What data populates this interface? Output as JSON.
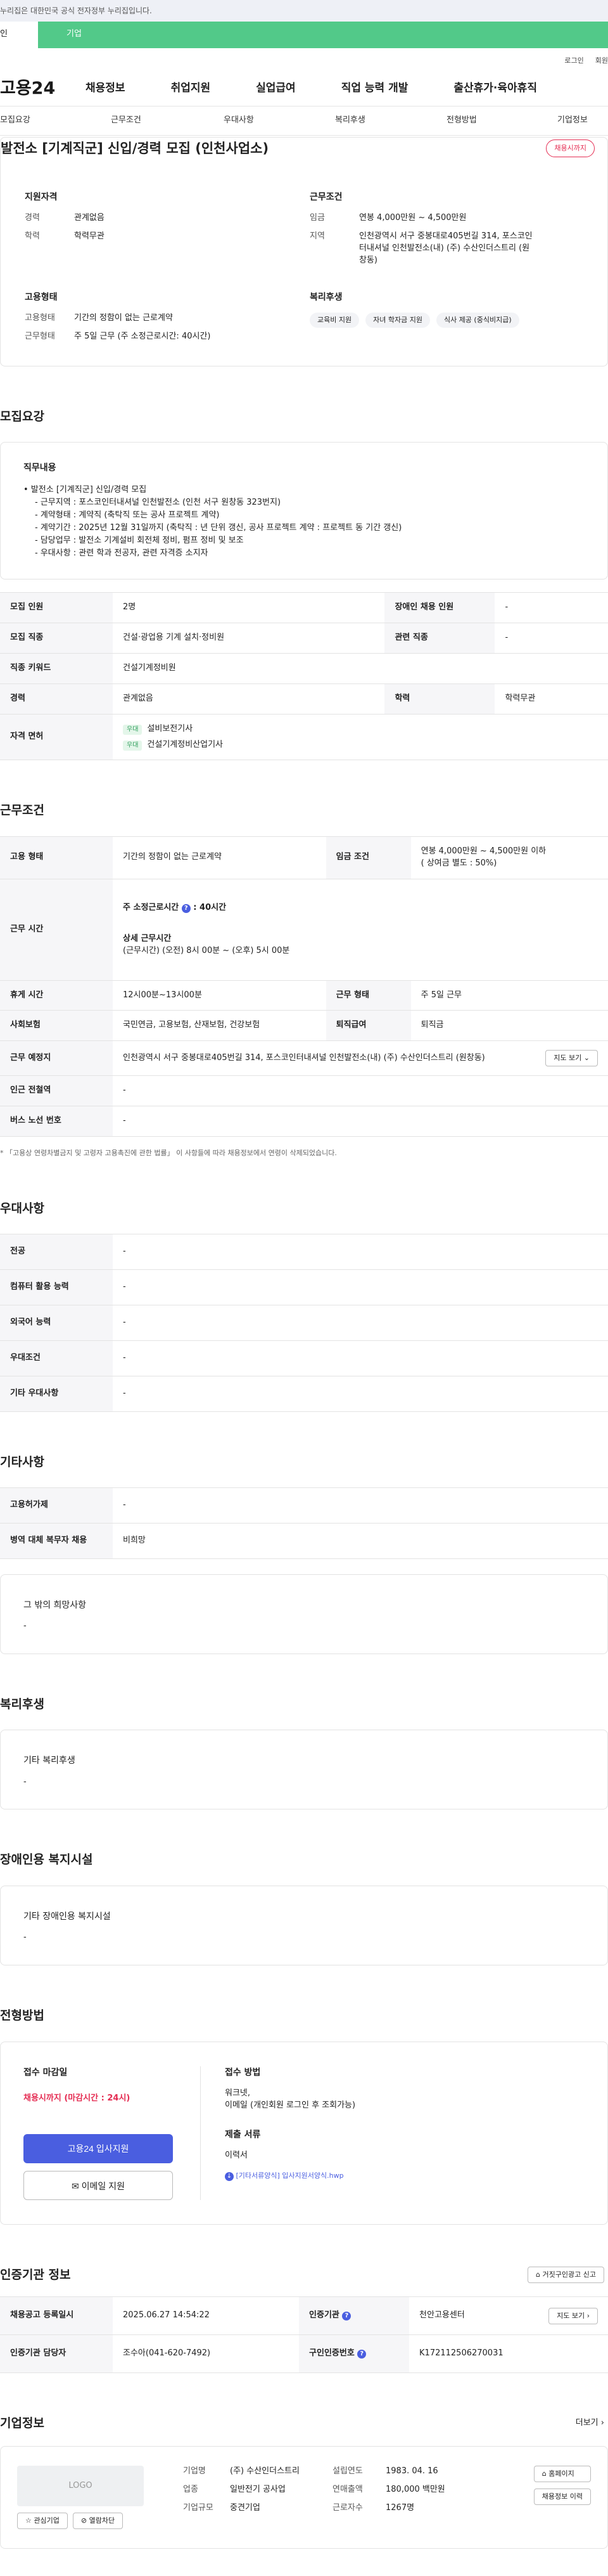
{
  "top_notice": "누리집은 대한민국 공식 전자정부 누리집입니다.",
  "user_tabs": {
    "individual": "인",
    "business": "기업"
  },
  "util_links": [
    "로그인",
    "회원"
  ],
  "logo": "고용24",
  "gnb": [
    "채용정보",
    "취업지원",
    "실업급여",
    "직업 능력 개발",
    "출산휴가·육아휴직"
  ],
  "subnav": [
    "모집요강",
    "근무조건",
    "우대사항",
    "복리후생",
    "전형방법",
    "기업정보"
  ],
  "job": {
    "title": "발전소 [기계직군] 신입/경력 모집 (인천사업소)",
    "deadline_badge": "채용시까지",
    "qual_head": "지원자격",
    "qual": [
      {
        "k": "경력",
        "v": "관계없음"
      },
      {
        "k": "학력",
        "v": "학력무관"
      }
    ],
    "cond_head": "근무조건",
    "cond": [
      {
        "k": "임금",
        "v": "연봉 4,000만원 ~ 4,500만원"
      },
      {
        "k": "지역",
        "v": "인천광역시 서구 중봉대로405번길 314, 포스코인터내셔널 인천발전소(내) (주) 수산인더스트리 (원창동)"
      }
    ],
    "emp_head": "고용형태",
    "emp": [
      {
        "k": "고용형태",
        "v": "기간의 정함이 없는 근로계약"
      },
      {
        "k": "근무형태",
        "v": "주 5일 근무 (주 소정근로시간: 40시간)"
      }
    ],
    "welfare_head": "복리후생",
    "welfare_chips": [
      "교육비 지원",
      "자녀 학자금 지원",
      "식사 제공 (중식비지급)"
    ]
  },
  "recruit": {
    "title": "모집요강",
    "duty_head": "직무내용",
    "duty_lines": [
      "• 발전소 [기계직군] 신입/경력 모집",
      "  - 근무지역 : 포스코인터내셔널 인천발전소 (인천 서구 원창동 323번지)",
      "  - 계약형태 : 계약직 (축탁직 또는 공사 프로젝트 계약)",
      "  - 계약기간 : 2025년 12월 31일까지 (축탁직 : 년 단위 갱신, 공사 프로젝트 계약 : 프로젝트 동 기간 갱신)",
      "  - 담당업무 : 발전소 기계설비 회전체 정비, 펌프 정비 및 보조",
      "  - 우대사항 : 관련 학과 전공자, 관련 자격증 소지자"
    ],
    "table": {
      "headcount_k": "모집 인원",
      "headcount_v": "2명",
      "disabled_k": "장애인 채용 인원",
      "disabled_v": "-",
      "job_k": "모집 직종",
      "job_v": "건설·광업용 기계 설치·정비원",
      "related_k": "관련 직종",
      "related_v": "-",
      "keyword_k": "직종 키워드",
      "keyword_v": "건설기계정비원",
      "career_k": "경력",
      "career_v": "관계없음",
      "edu_k": "학력",
      "edu_v": "학력무관",
      "license_k": "자격 면허",
      "licenses": [
        {
          "tag": "우대",
          "name": "설비보전기사"
        },
        {
          "tag": "우대",
          "name": "건설기계정비산업기사"
        }
      ]
    }
  },
  "work": {
    "title": "근무조건",
    "emp_k": "고용 형태",
    "emp_v": "기간의 정함이 없는 근로계약",
    "wage_k": "임금 조건",
    "wage_v": "연봉 4,000만원 ~ 4,500만원 이하",
    "wage_sub": "( 상여금 별도 : 50%)",
    "time_k": "근무 시간",
    "time_week": "주 소정근로시간",
    "time_week_v": "40시간",
    "time_detail_head": "상세 근무시간",
    "time_detail": "(근무시간) (오전) 8시 00분 ~ (오후) 5시 00분",
    "break_k": "휴게 시간",
    "break_v": "12시00분~13시00분",
    "shift_k": "근무 형태",
    "shift_v": "주 5일 근무",
    "insurance_k": "사회보험",
    "insurance_v": "국민연금, 고용보험, 산재보험, 건강보험",
    "retire_k": "퇴직급여",
    "retire_v": "퇴직금",
    "place_k": "근무 예정지",
    "place_v": "인천광역시 서구 중봉대로405번길 314, 포스코인터내셔널 인천발전소(내) (주) 수산인더스트리 (원창동)",
    "map_btn": "지도 보기",
    "subway_k": "인근 전철역",
    "subway_v": "-",
    "bus_k": "버스 노선 번호",
    "bus_v": "-",
    "note": "* 「고용상 연령차별금지 및 고령자 고용촉진에 관한 법률」 이 사항들에 따라 채용정보에서 연령이 삭제되었습니다."
  },
  "pref": {
    "title": "우대사항",
    "rows": [
      {
        "k": "전공",
        "v": "-"
      },
      {
        "k": "컴퓨터 활용 능력",
        "v": "-"
      },
      {
        "k": "외국어 능력",
        "v": "-"
      },
      {
        "k": "우대조건",
        "v": "-"
      },
      {
        "k": "기타 우대사항",
        "v": "-"
      }
    ]
  },
  "etc": {
    "title": "기타사항",
    "rows": [
      {
        "k": "고용허가제",
        "v": "-"
      },
      {
        "k": "병역 대체 복무자 채용",
        "v": "비희망"
      }
    ],
    "other_head": "그 밖의 희망사항",
    "other_v": "-"
  },
  "benefit": {
    "title": "복리후생",
    "head": "기타 복리후생",
    "v": "-"
  },
  "accessibility": {
    "title": "장애인용 복지시설",
    "head": "기타 장애인용 복지시설",
    "v": "-"
  },
  "process": {
    "title": "전형방법",
    "deadline_head": "접수 마감일",
    "deadline_v": "채용시까지 (마감시간 : 24시)",
    "apply_btn": "고용24 입사지원",
    "email_btn": "이메일 지원",
    "method_head": "접수 방법",
    "method_v1": "워크넷,",
    "method_v2": "이메일 (개인회원 로그인 후 조회가능)",
    "docs_head": "제출 서류",
    "docs_v": "이력서",
    "docs_file": "[기타서류양식] 입사지원서양식.hwp"
  },
  "cert": {
    "title": "인증기관 정보",
    "report_btn": "거짓구인광고 신고",
    "reg_k": "채용공고 등록일시",
    "reg_v": "2025.06.27 14:54:22",
    "org_k": "인증기관",
    "org_v": "천안고용센터",
    "org_btn": "지도 보기",
    "manager_k": "인증기관 담당자",
    "manager_v": "조수아(041-620-7492)",
    "id_k": "구인인증번호",
    "id_v": "K172112506270031"
  },
  "company": {
    "title": "기업정보",
    "more": "더보기",
    "logo_placeholder": "LOGO",
    "fav_btn": "관심기업",
    "block_btn": "열람차단",
    "name_k": "기업명",
    "name_v": "(주) 수산인더스트리",
    "industry_k": "업종",
    "industry_v": "일반전기 공사업",
    "scale_k": "기업규모",
    "scale_v": "중견기업",
    "founded_k": "설립연도",
    "founded_v": "1983. 04. 16",
    "sales_k": "연매출액",
    "sales_v": "180,000 백만원",
    "staff_k": "근로자수",
    "staff_v": "1267명",
    "home_btn": "홈페이지",
    "jobs_btn": "채용정보 이력"
  }
}
